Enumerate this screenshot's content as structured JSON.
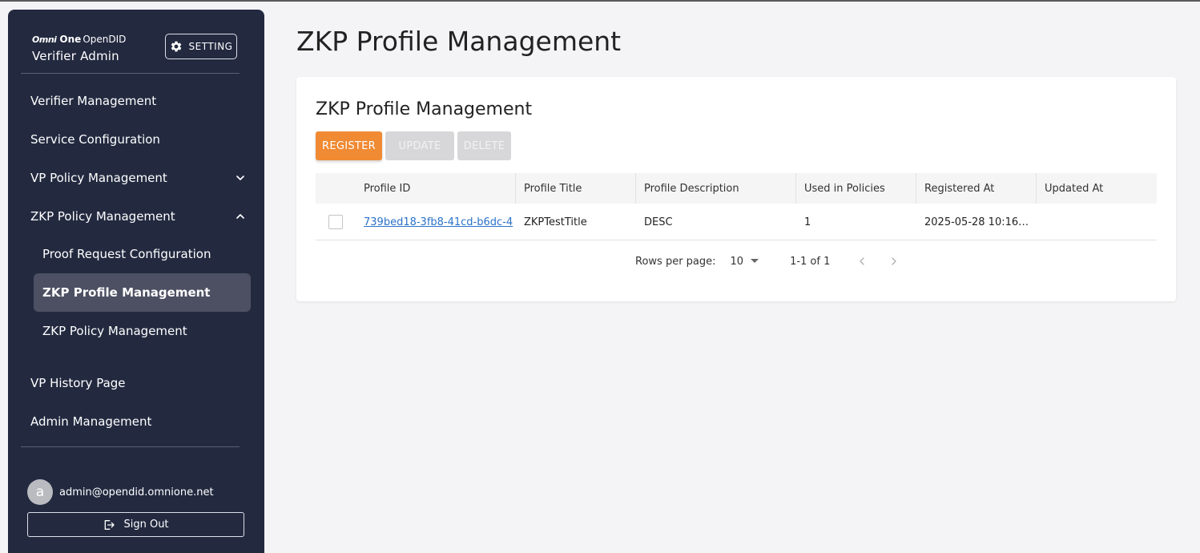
{
  "sidebar": {
    "brand": {
      "logo_mark": "Omni",
      "logo_one": "One",
      "logo_rest": "OpenDID",
      "subtitle": "Verifier Admin"
    },
    "setting_label": "SETTING",
    "items": [
      {
        "label": "Verifier Management"
      },
      {
        "label": "Service Configuration"
      },
      {
        "label": "VP Policy Management"
      },
      {
        "label": "ZKP Policy Management"
      },
      {
        "label": "VP History Page"
      },
      {
        "label": "Admin Management"
      }
    ],
    "subitems": [
      {
        "label": "Proof Request Configuration"
      },
      {
        "label": "ZKP Profile Management"
      },
      {
        "label": "ZKP Policy Management"
      }
    ],
    "user": {
      "avatar_initial": "a",
      "email": "admin@opendid.omnione.net"
    },
    "signout_label": "Sign Out"
  },
  "main": {
    "page_title": "ZKP Profile Management",
    "card_title": "ZKP Profile Management",
    "buttons": {
      "register": "REGISTER",
      "update": "UPDATE",
      "delete": "DELETE"
    },
    "table": {
      "headers": [
        "Profile ID",
        "Profile Title",
        "Profile Description",
        "Used in Policies",
        "Registered At",
        "Updated At"
      ],
      "rows": [
        {
          "profile_id": "739bed18-3fb8-41cd-b6dc-4",
          "title": "ZKPTestTitle",
          "description": "DESC",
          "used_in_policies": "1",
          "registered_at": "2025-05-28 10:16…",
          "updated_at": ""
        }
      ]
    },
    "pagination": {
      "rows_per_page_label": "Rows per page:",
      "rows_per_page_value": "10",
      "page_info": "1-1 of 1"
    }
  },
  "colors": {
    "sidebar_bg": "#232a40",
    "accent": "#f08a33",
    "active_item_bg": "#4c5062",
    "link": "#2a72c8"
  }
}
